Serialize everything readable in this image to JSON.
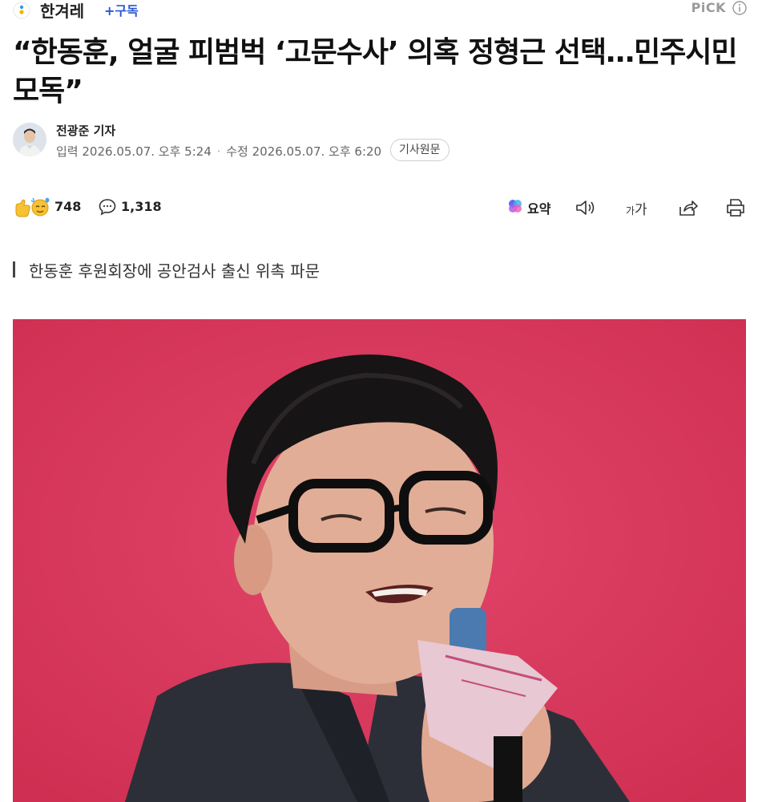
{
  "header": {
    "press_name": "한겨레",
    "subscribe_label": "+구독",
    "pick_label": "PiCK"
  },
  "article": {
    "headline": "“한동훈, 얼굴 피범벅 ‘고문수사’ 의혹 정형근 선택…민주시민 모독”",
    "reporter": "전광준 기자",
    "published_label": "입력",
    "published": "2026.05.07. 오후 5:24",
    "modified_label": "수정",
    "modified": "2026.05.07. 오후 6:20",
    "original_button": "기사원문",
    "subheadline": "한동훈 후원회장에 공안검사 출신 위촉 파문"
  },
  "actions": {
    "reactions_count": "748",
    "comments_count": "1,318",
    "summary_label": "요약",
    "font_size_label_small": "가",
    "font_size_label_large": "가"
  },
  "icons": {
    "logo": "hankyoreh-logo-icon",
    "info": "info-circle-icon",
    "reactions": "emoji-reaction-icon",
    "comments": "speech-bubble-icon",
    "summary": "ai-summary-icon",
    "tts": "speaker-icon",
    "font": "font-size-icon",
    "share": "share-icon",
    "print": "print-icon"
  },
  "colors": {
    "subscribe": "#2a57d6",
    "photo_background": "#d8385a"
  }
}
